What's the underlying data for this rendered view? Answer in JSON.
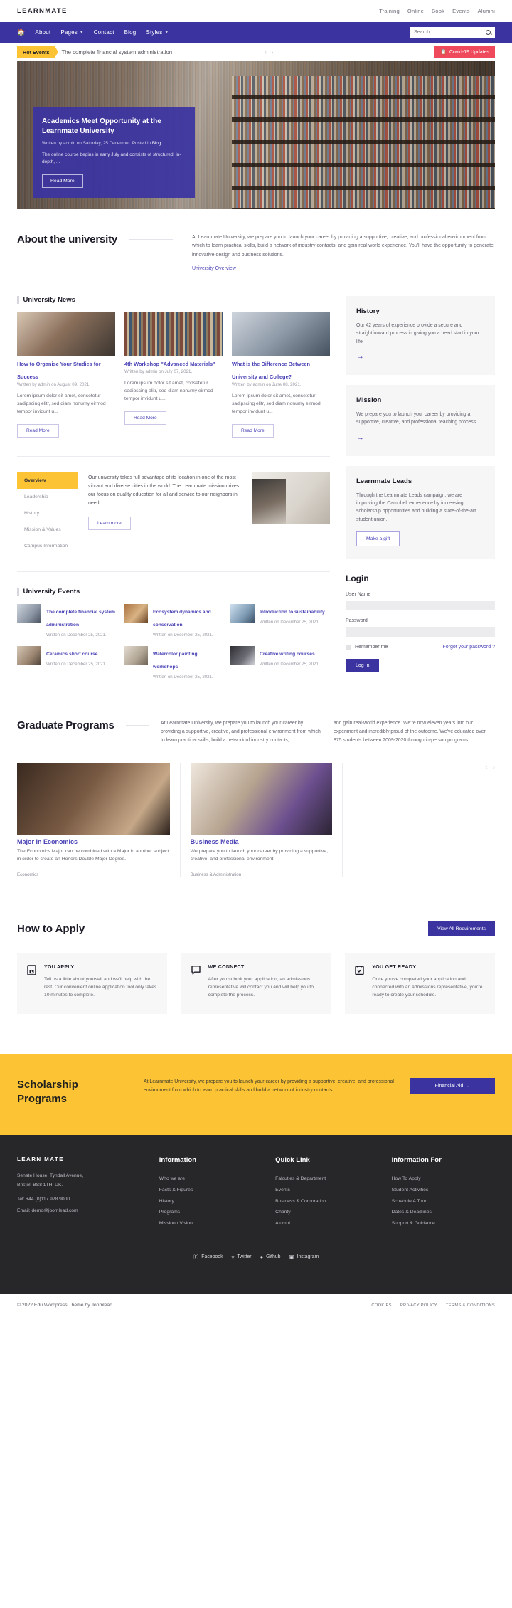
{
  "topbar": {
    "brand": "LEARNMATE",
    "links": [
      "Training",
      "Online",
      "Book",
      "Events",
      "Alumni"
    ]
  },
  "nav": {
    "home_icon": "home-icon",
    "items": [
      {
        "label": "About",
        "caret": false
      },
      {
        "label": "Pages",
        "caret": true
      },
      {
        "label": "Contact",
        "caret": false
      },
      {
        "label": "Blog",
        "caret": false
      },
      {
        "label": "Styles",
        "caret": true
      }
    ],
    "search_placeholder": "Search...",
    "search_value": ""
  },
  "hotbar": {
    "tag": "Hot Events",
    "title": "The complete financial system administration",
    "prev": "‹",
    "next": "›",
    "covid_label": "Covid-19 Updates"
  },
  "hero": {
    "title": "Academics Meet Opportunity at the Learnmate University",
    "meta_prefix": "Written by admin on Saturday, 25 December. Posted in ",
    "meta_link": "Blog",
    "desc": "The online course begins in early July and consists of structured, in-depth, ...",
    "button": "Read More"
  },
  "about": {
    "title": "About the university",
    "body": "At Learnmate University, we prepare you to launch your career by providing a supportive, creative, and professional environment from which to learn practical skills, build a network of industry contacts, and gain real-world experience. You'll have the opportunity to generate innovative design and business solutions.",
    "link": "University Overview"
  },
  "news": {
    "heading": "University News",
    "read_more": "Read More",
    "items": [
      {
        "title": "How to Organise Your Studies for Success",
        "meta": "Written by admin on August 09, 2021.",
        "excerpt": "Lorem ipsum dolor sit amet, consetetur sadipscing elitr, sed diam nonumy eirmod tempor invidunt u..."
      },
      {
        "title": "4th Workshop \"Advanced Materials\"",
        "meta": "Written by admin on July 07, 2021.",
        "excerpt": "Lorem ipsum dolor sit amet, consetetur sadipscing elitr, sed diam nonumy eirmod tempor invidunt u..."
      },
      {
        "title": "What is the Difference Between University and College?",
        "meta": "Written by admin on June 08, 2021.",
        "excerpt": "Lorem ipsum dolor sit amet, consetetur sadipscing elitr, sed diam nonumy eirmod tempor invidunt u..."
      }
    ]
  },
  "sidebar": {
    "history": {
      "title": "History",
      "body": "Our 42 years of experience provide a secure and straightforward process in giving you a head start in your life",
      "arrow": "→"
    },
    "mission": {
      "title": "Mission",
      "body": "We prepare you to launch your career by providing a supportive, creative, and professional teaching process.",
      "arrow": "→"
    },
    "leads": {
      "title": "Learnmate Leads",
      "body": "Through the Learnmate Leads campaign, we are improving the Campbell experience by increasing scholarship opportunities and building a state-of-the-art student union.",
      "button": "Make a gift"
    },
    "login": {
      "title": "Login",
      "username_label": "User Name",
      "username_value": "",
      "password_label": "Password",
      "password_value": "",
      "remember_label": "Remember me",
      "forgot_label": "Forgot your password ?",
      "submit_label": "Log In"
    }
  },
  "tabs": {
    "items": [
      {
        "label": "Overview",
        "active": true
      },
      {
        "label": "Leadership",
        "active": false
      },
      {
        "label": "History",
        "active": false
      },
      {
        "label": "Mission & Values",
        "active": false
      },
      {
        "label": "Campus Information",
        "active": false
      }
    ],
    "body": "Our university takes full advantage of its location in one of the most vibrant and diverse cities in the world. The Learnmate mission drives our focus on quality education for all and service to our neighbors in need.",
    "button": "Learn more"
  },
  "events": {
    "heading": "University Events",
    "items": [
      {
        "title": "The complete financial system administration",
        "meta": "Written on December 25, 2021."
      },
      {
        "title": "Ecosystem dynamics and conservation",
        "meta": "Written on December 25, 2021."
      },
      {
        "title": "Introduction to sustainability",
        "meta": "Written on December 25, 2021."
      },
      {
        "title": "Ceramics short course",
        "meta": "Written on December 25, 2021."
      },
      {
        "title": "Watercolor painting workshops",
        "meta": "Written on December 25, 2021."
      },
      {
        "title": "Creative writing courses",
        "meta": "Written on December 25, 2021."
      }
    ]
  },
  "programs": {
    "title": "Graduate Programs",
    "col1": "At Learnmate University, we prepare you to launch your career by providing a supportive, creative, and professional environment from which to learn practical skills, build a network of industry contacts,",
    "col2": "and gain real-world experience. We're now eleven years into our experiment and incredibly proud of the outcome. We've educated over 875 students between 2009-2020 through in-person programs.",
    "prev": "‹",
    "next": "›",
    "cards": [
      {
        "title": "Major in Economics",
        "desc": "The Economics Major can be combined with a Major in another subject in order to create an Honors Double Major Degree.",
        "tag": "Economics"
      },
      {
        "title": "Business Media",
        "desc": "We prepare you to launch your career by providing a supportive, creative, and professional environment",
        "tag": "Business & Administration"
      }
    ]
  },
  "apply": {
    "title": "How to Apply",
    "button": "View All Requirements",
    "steps": [
      {
        "icon": "document-download-icon",
        "title": "YOU APPLY",
        "body": "Tell us a little about yourself and we'll help with the rest. Our convenient online application tool only takes 10 minutes to complete."
      },
      {
        "icon": "chat-bubble-icon",
        "title": "WE CONNECT",
        "body": "After you submit your application, an admissions representative will contact you and will help you to complete the process."
      },
      {
        "icon": "calendar-check-icon",
        "title": "YOU GET READY",
        "body": "Once you've completed your application and connected with an admissions representative, you're ready to create your schedule."
      }
    ]
  },
  "scholarship": {
    "title": "Scholarship Programs",
    "body": "At Learnmate University, we prepare you to launch your career by providing a supportive, creative, and professional environment from which to learn practical skills and build a network of industry contacts.",
    "button": "Financial Aid →"
  },
  "footer": {
    "brand": "LEARN MATE",
    "address_line1": "Senate House, Tyndall Avenue,",
    "address_line2": "Bristol, BS8 1TH, UK.",
    "tel": "Tel: +44 (0)117 928 9000",
    "email": "Email: demo@joomlead.com",
    "columns": [
      {
        "heading": "Information",
        "links": [
          "Who we are",
          "Facts & Figures",
          "History",
          "Programs",
          "Mission / Vision"
        ]
      },
      {
        "heading": "Quick Link",
        "links": [
          "Falcuties & Department",
          "Events",
          "Business & Corporation",
          "Charity",
          "Alumni"
        ]
      },
      {
        "heading": "Information For",
        "links": [
          "How To Apply",
          "Student Activities",
          "Schedule A Tour",
          "Dates & Deadlines",
          "Support & Guidance"
        ]
      }
    ],
    "social": [
      {
        "icon": "facebook-icon",
        "glyph": "Ⓕ",
        "label": "Facebook"
      },
      {
        "icon": "twitter-icon",
        "glyph": "ᴠ",
        "label": "Twitter"
      },
      {
        "icon": "github-icon",
        "glyph": "●",
        "label": "Github"
      },
      {
        "icon": "instagram-icon",
        "glyph": "▣",
        "label": "Instagram"
      }
    ],
    "copyright": "© 2022 Edu Wordpress Theme by Joomlead.",
    "legal": [
      "COOKIES",
      "PRIVACY POLICY",
      "TERMS & CONDITIONS"
    ]
  },
  "colors": {
    "primary": "#3b34a0",
    "accent_yellow": "#fcc434",
    "link": "#4a42b5",
    "covid_red": "#ef4a5c",
    "footer_bg": "#27272a"
  }
}
